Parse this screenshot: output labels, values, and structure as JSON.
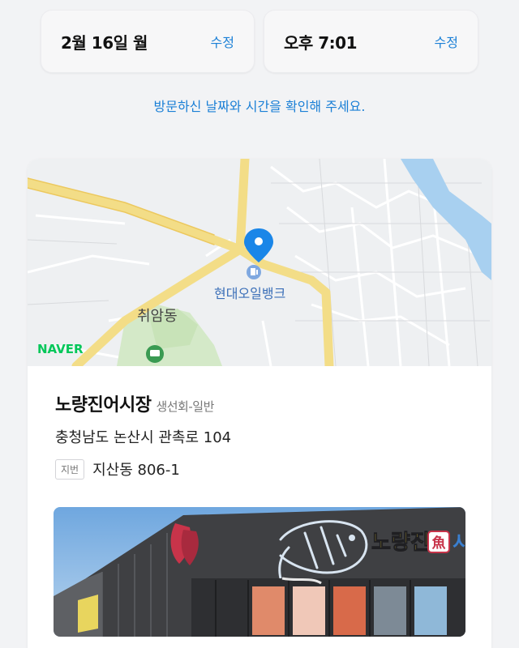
{
  "visit": {
    "date": "2월 16일 월",
    "date_edit_label": "수정",
    "time": "오후 7:01",
    "time_edit_label": "수정",
    "hint": "방문하신 날짜와 시간을 확인해 주세요."
  },
  "map": {
    "poi_label": "현대오일뱅크",
    "area_label": "취암동",
    "provider_logo": "NAVER"
  },
  "store": {
    "name": "노량진어시장",
    "category": "생선회-일반",
    "road_address": "충청남도 논산시 관촉로 104",
    "jibun_label": "지번",
    "jibun_address": "지산동 806-1"
  },
  "photo": {
    "sign_text": "노량진",
    "sign_badge": "魚",
    "sign_text_tail": "시"
  },
  "colors": {
    "accent": "#1a7fd6",
    "naver_green": "#03c75a",
    "pin": "#1a86e8"
  }
}
